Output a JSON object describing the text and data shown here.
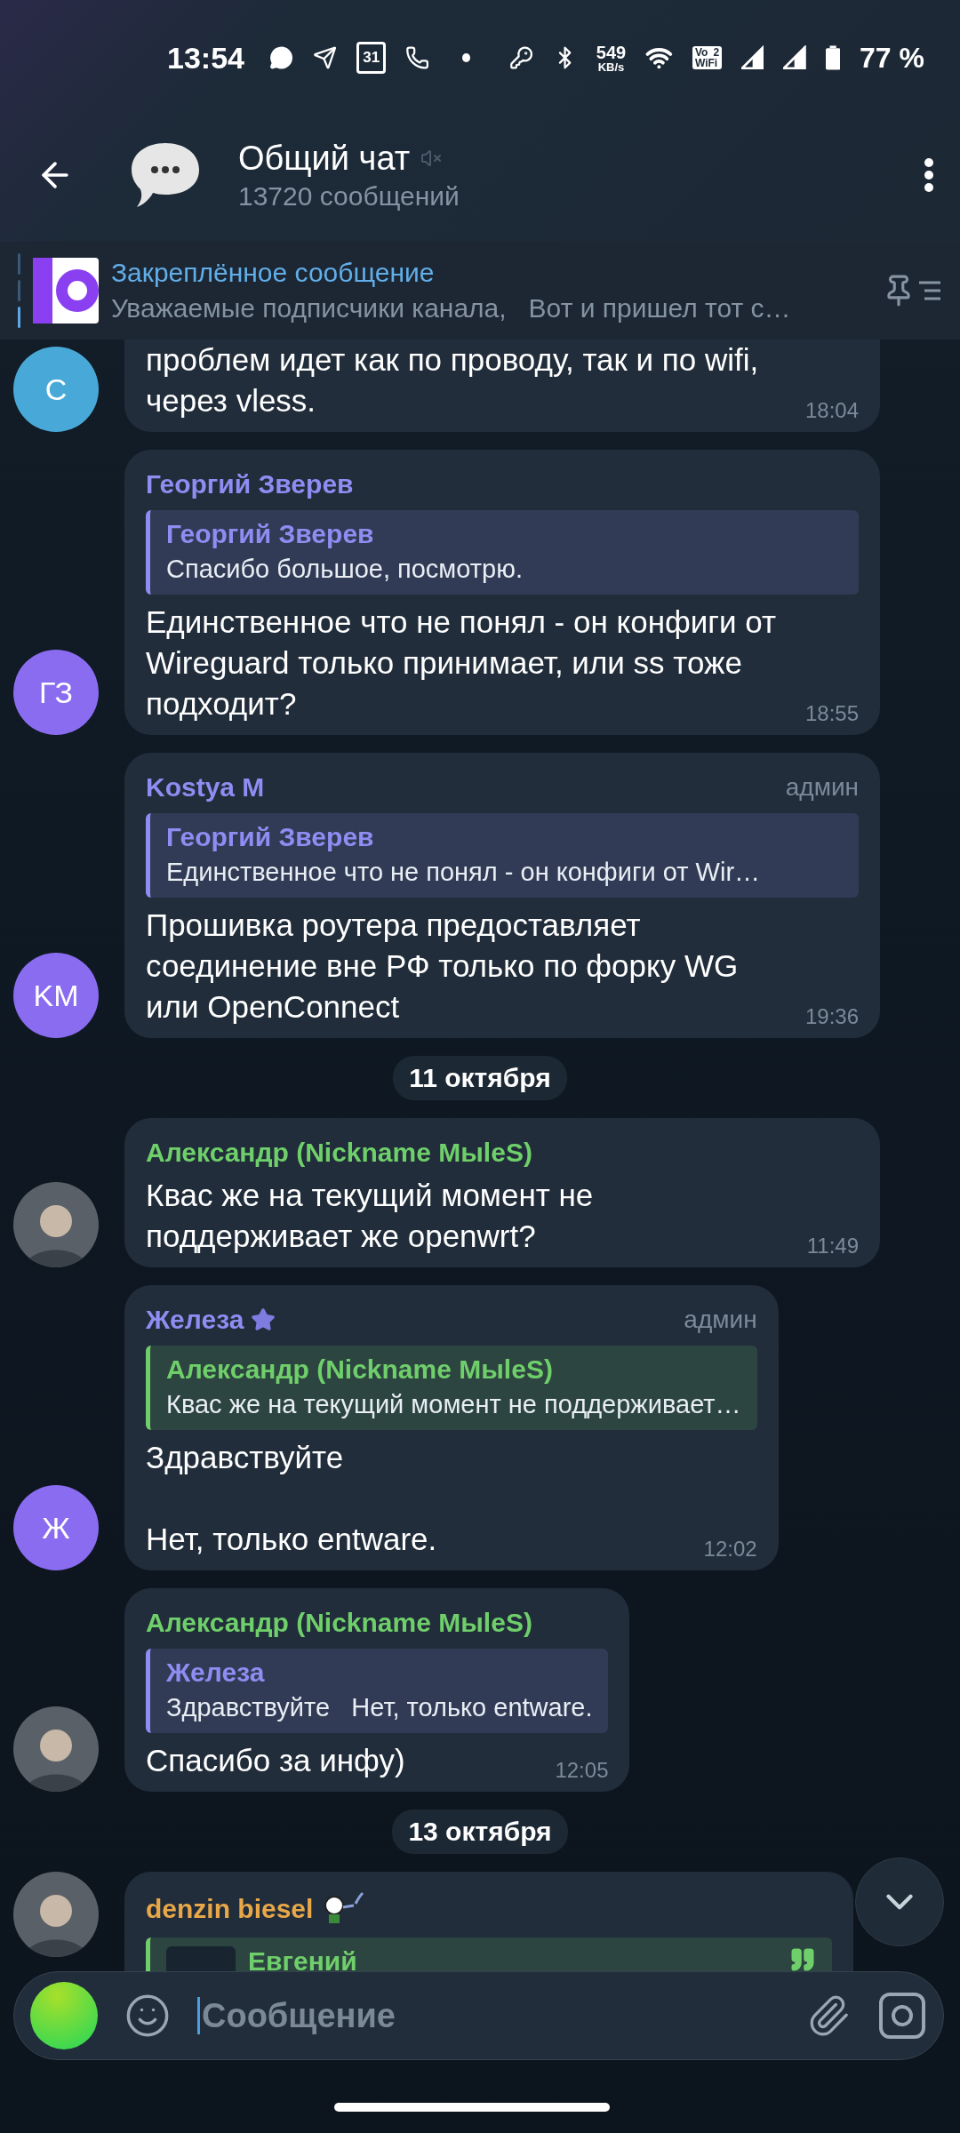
{
  "status_bar": {
    "time": "13:54",
    "calendar_day": "31",
    "net_speed": "549",
    "net_unit": "KB/s",
    "vowifi": {
      "top": "Vo",
      "sim": "2",
      "bottom": "WiFi"
    },
    "battery": "77 %"
  },
  "header": {
    "title": "Общий чат",
    "muted": true,
    "subtitle": "13720 сообщений"
  },
  "pinned": {
    "title": "Закреплённое сообщение",
    "text": "Уважаемые подписчики канала,   Вот и пришел тот с…"
  },
  "messages": [
    {
      "kind": "message",
      "cut_top": true,
      "avatar": {
        "kind": "initials",
        "initials": "С",
        "color": "#48a9d8"
      },
      "text": "проблем идет как по проводу, так и по wifi, через vless.",
      "time": "18:04"
    },
    {
      "kind": "message",
      "author": {
        "name": "Георгий Зверев",
        "color": "#8f8cf2"
      },
      "avatar": {
        "kind": "initials",
        "initials": "ГЗ",
        "color": "#8a6cf0"
      },
      "reply": {
        "author": {
          "name": "Георгий Зверев",
          "color": "#8f8cf2"
        },
        "text": "Спасибо большое, посмотрю."
      },
      "text": "Единственное что не понял - он конфиги от Wireguard только принимает, или ss тоже подходит?",
      "time": "18:55"
    },
    {
      "kind": "message",
      "author": {
        "name": "Kostya M",
        "color": "#8f8cf2"
      },
      "badge": "админ",
      "avatar": {
        "kind": "initials",
        "initials": "KM",
        "color": "#8a6cf0"
      },
      "reply": {
        "author": {
          "name": "Георгий Зверев",
          "color": "#8f8cf2"
        },
        "text": "Единственное что не понял - он конфиги от Wir…"
      },
      "text": "Прошивка роутера предоставляет соединение вне РФ только по форку WG или OpenConnect",
      "time": "19:36"
    },
    {
      "kind": "date",
      "text": "11 октября"
    },
    {
      "kind": "message",
      "author": {
        "name": "Александр (Nickname МыleS)",
        "color": "#6fcf6a"
      },
      "avatar": {
        "kind": "photo"
      },
      "text": "Квас же на текущий момент не поддерживает же openwrt?",
      "time": "11:49"
    },
    {
      "kind": "message",
      "author": {
        "name": "Железа",
        "color": "#8f8cf2"
      },
      "premium": true,
      "badge": "админ",
      "avatar": {
        "kind": "initials",
        "initials": "Ж",
        "color": "#8a6cf0"
      },
      "reply": {
        "author": {
          "name": "Александр (Nickname МыleS)",
          "color": "#6fcf6a"
        },
        "text": "Квас же на текущий момент не поддерживает…"
      },
      "text": "Здравствуйте\n\nНет, только entware.",
      "time": "12:02"
    },
    {
      "kind": "message",
      "author": {
        "name": "Александр (Nickname МыleS)",
        "color": "#6fcf6a"
      },
      "avatar": {
        "kind": "photo"
      },
      "reply": {
        "author": {
          "name": "Железа",
          "color": "#8f8cf2"
        },
        "text": "Здравствуйте   Нет, только entware."
      },
      "text": "Спасибо за инфу)",
      "time": "12:05"
    },
    {
      "kind": "date",
      "text": "13 октября"
    },
    {
      "kind": "message",
      "cut_bottom": true,
      "author": {
        "name": "denzin biesel",
        "color": "#e8a748"
      },
      "sticker": true,
      "avatar": {
        "kind": "photo"
      },
      "reply": {
        "author": {
          "name": "Евгений",
          "color": "#6fcf6a"
        },
        "thumbnail": true,
        "quote": true
      }
    }
  ],
  "composer": {
    "placeholder": "Сообщение"
  }
}
